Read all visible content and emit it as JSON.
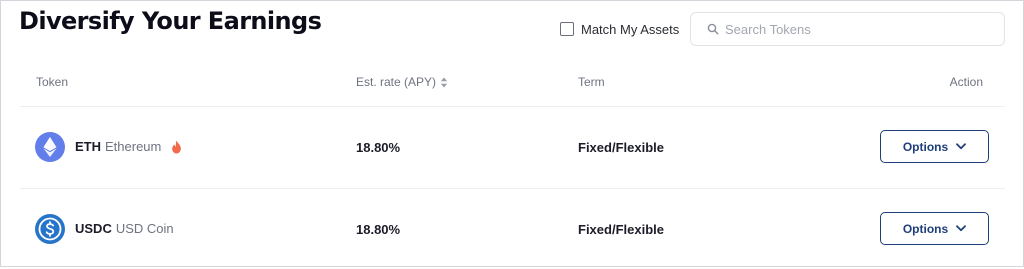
{
  "header": {
    "title": "Diversify Your Earnings",
    "match_assets_label": "Match My Assets",
    "match_assets_checked": false,
    "search_placeholder": "Search Tokens"
  },
  "table": {
    "columns": {
      "token": "Token",
      "rate": "Est. rate (APY)",
      "term": "Term",
      "action": "Action"
    },
    "rows": [
      {
        "symbol": "ETH",
        "name": "Ethereum",
        "icon": "ethereum-icon",
        "hot": true,
        "rate": "18.80%",
        "term": "Fixed/Flexible",
        "action_label": "Options"
      },
      {
        "symbol": "USDC",
        "name": "USD Coin",
        "icon": "usdc-icon",
        "hot": false,
        "rate": "18.80%",
        "term": "Fixed/Flexible",
        "action_label": "Options"
      }
    ]
  },
  "colors": {
    "accent": "#1f3f7a",
    "eth": "#627eea",
    "usdc": "#2775ca",
    "fire": "#f26a4b"
  }
}
